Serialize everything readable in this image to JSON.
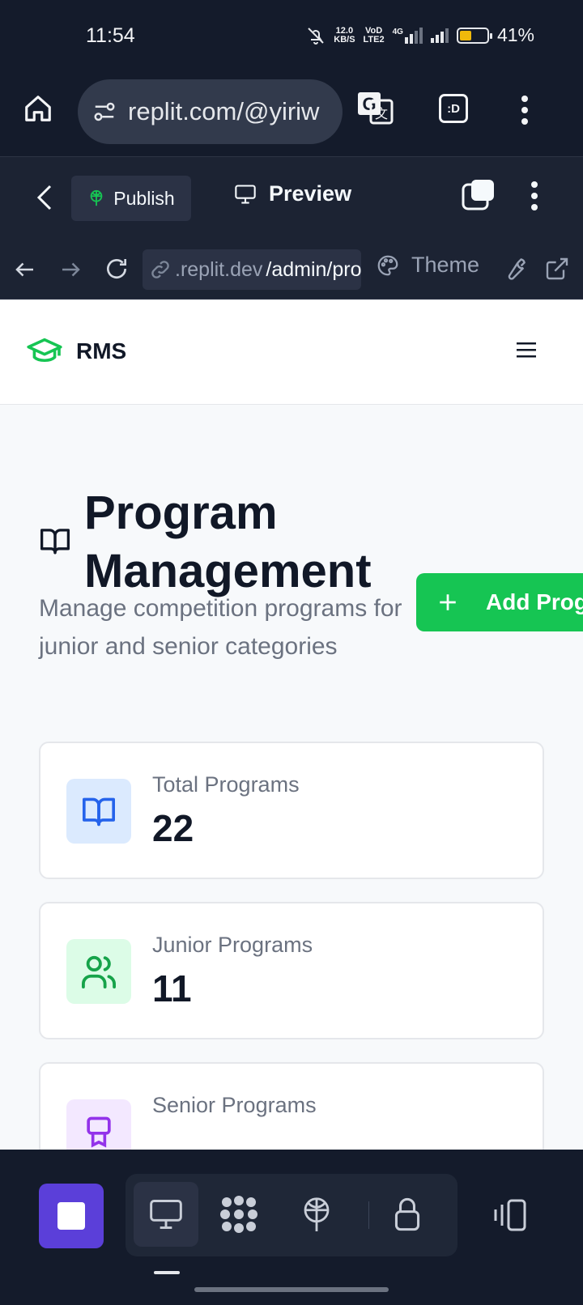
{
  "status_bar": {
    "time": "11:54",
    "net_speed_value": "12.0",
    "net_speed_unit": "KB/S",
    "volte_top": "VoD",
    "volte_bottom": "LTE2",
    "network": "4G",
    "battery": "41%",
    "battery_level": 0.41,
    "battery_color": "#f0b90b"
  },
  "browser": {
    "url": "replit.com/@yiriw",
    "tab_badge": ":D"
  },
  "replit_toolbar": {
    "publish_label": "Publish",
    "preview_label": "Preview"
  },
  "webview_nav": {
    "url_host": ".replit.dev",
    "url_path": "/admin/pro",
    "theme_label": "Theme"
  },
  "app": {
    "brand": "RMS",
    "brand_color": "#16c553",
    "title": "Program Management",
    "subtitle": "Manage competition programs for junior and senior categories",
    "add_button_label": "Add Prog",
    "stats": [
      {
        "label": "Total Programs",
        "value": "22",
        "icon": "book-open-icon",
        "bg": "#dbeafe",
        "color": "#2563eb"
      },
      {
        "label": "Junior Programs",
        "value": "11",
        "icon": "users-icon",
        "bg": "#dcfce7",
        "color": "#16a34a"
      },
      {
        "label": "Senior Programs",
        "value": "",
        "icon": "award-icon",
        "bg": "#f3e8ff",
        "color": "#9333ea"
      }
    ]
  },
  "dock": {
    "accent": "#5b3fd9"
  }
}
